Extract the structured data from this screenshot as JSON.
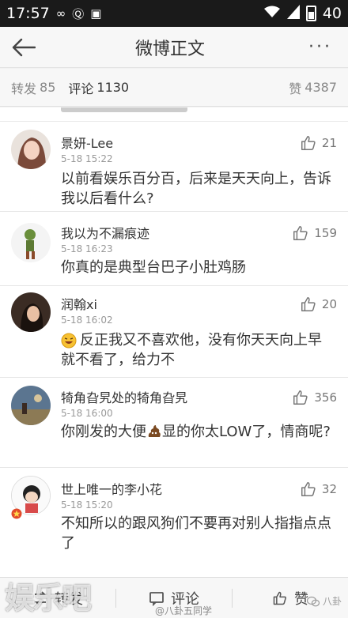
{
  "status_bar": {
    "time": "17:57",
    "battery_level": "40"
  },
  "header": {
    "title": "微博正文",
    "more_label": "···"
  },
  "tabs": {
    "repost_label": "转发",
    "repost_count": "85",
    "comment_label": "评论",
    "comment_count": "1130",
    "like_label": "赞",
    "like_count": "4387"
  },
  "comments": [
    {
      "name": "景妍-Lee",
      "time": "5-18 15:22",
      "text": "以前看娱乐百分百，后来是天天向上，告诉我以后看什么?",
      "likes": "21"
    },
    {
      "name": "我以为不漏痕迹",
      "time": "5-18 16:23",
      "text": "你真的是典型台巴子小肚鸡肠",
      "likes": "159"
    },
    {
      "name": "润翰xi",
      "time": "5-18 16:02",
      "text": "反正我又不喜欢他，没有你天天向上早就不看了，给力不",
      "likes": "20"
    },
    {
      "name": "犄角旮旯处的犄角旮旯",
      "time": "5-18 16:00",
      "text_before": "你刚发的大便",
      "text_after": "显的你太LOW了，情商呢?",
      "likes": "356"
    },
    {
      "name": "世上唯一的李小花",
      "time": "5-18 15:20",
      "text": "不知所以的跟风狗们不要再对别人指指点点了",
      "likes": "32"
    }
  ],
  "bottom_bar": {
    "repost": "转发",
    "comment": "评论",
    "like": "赞"
  },
  "watermarks": {
    "left": "娱乐吧",
    "credit": "@八卦五同学",
    "right": "八卦"
  },
  "colors": {
    "accent": "#e6a23c",
    "status_bar": "#1a1a1a",
    "background": "#f2f2f2"
  }
}
